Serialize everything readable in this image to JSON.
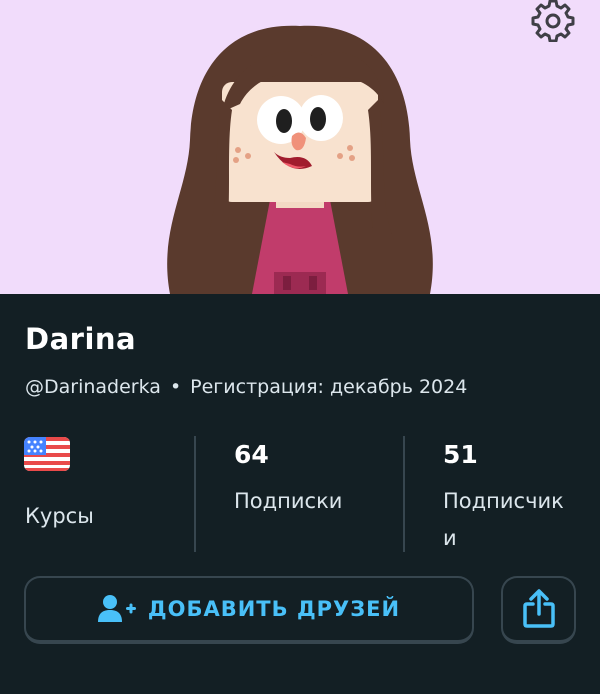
{
  "user": {
    "name": "Darina",
    "username": "@Darinaderka",
    "separator": "•",
    "joined": "Регистрация: декабрь 2024"
  },
  "stats": {
    "courses_label": "Курсы",
    "courses_flag": "us-flag-icon",
    "following_count": "64",
    "following_label": "Подписки",
    "followers_count": "51",
    "followers_label_line1": "Подписчик",
    "followers_label_line2": "и"
  },
  "actions": {
    "add_friends_label": "ДОБАВИТЬ ДРУЗЕЙ",
    "add_friends_icon": "add-user-icon",
    "share_icon": "share-icon",
    "settings_icon": "gear-icon"
  },
  "colors": {
    "hero_background": "#f1dcfb",
    "page_background": "#131f24",
    "accent_blue": "#49c0f8",
    "border": "#37464f"
  }
}
